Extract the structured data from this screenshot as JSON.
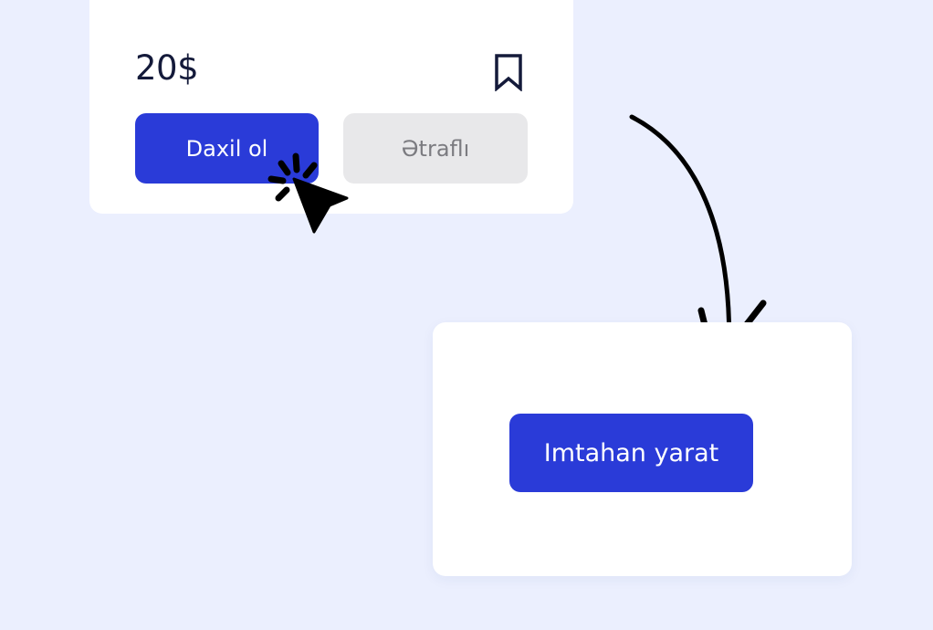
{
  "course_card": {
    "price": "20$",
    "join_label": "Daxil ol",
    "details_label": "Ətraflı",
    "bookmark_icon": "bookmark-icon"
  },
  "create_panel": {
    "create_label": "Imtahan yarat"
  },
  "icons": {
    "cursor": "click-cursor-icon",
    "arrow": "curved-arrow-icon"
  },
  "colors": {
    "background": "#ebeffe",
    "primary": "#2a3bd8",
    "secondary_button": "#e8e8ea",
    "text_dark": "#141a3a"
  }
}
